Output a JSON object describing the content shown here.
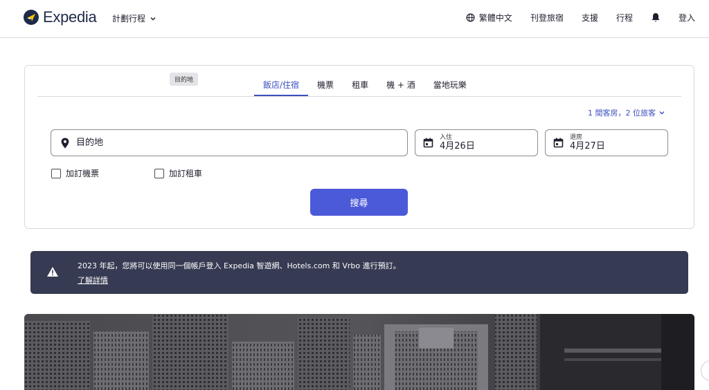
{
  "header": {
    "logo_text": "Expedia",
    "plan_trip": "計劃行程",
    "language": "繁體中文",
    "list_property": "刊登旅宿",
    "support": "支援",
    "trips": "行程",
    "sign_in": "登入"
  },
  "search": {
    "tooltip": "目的地",
    "tabs": [
      {
        "label": "飯店/住宿",
        "active": true
      },
      {
        "label": "機票"
      },
      {
        "label": "租車"
      },
      {
        "label": "機 + 酒"
      },
      {
        "label": "當地玩樂"
      }
    ],
    "travelers": "1 間客房，2 位旅客",
    "destination_placeholder": "目的地",
    "checkin_label": "入住",
    "checkin_value": "4月26日",
    "checkout_label": "退房",
    "checkout_value": "4月27日",
    "add_flight": "加訂機票",
    "add_car": "加訂租車",
    "search_button": "搜尋"
  },
  "banner": {
    "message": "2023 年起，您將可以使用同一個帳戶登入 Expedia 智遊網、Hotels.com 和 Vrbo 進行預訂。",
    "link": "了解詳情"
  },
  "colors": {
    "accent": "#3b4fbe",
    "button": "#4b5ad8",
    "banner_bg": "#363a52",
    "brand_dark": "#1e2a4a"
  }
}
